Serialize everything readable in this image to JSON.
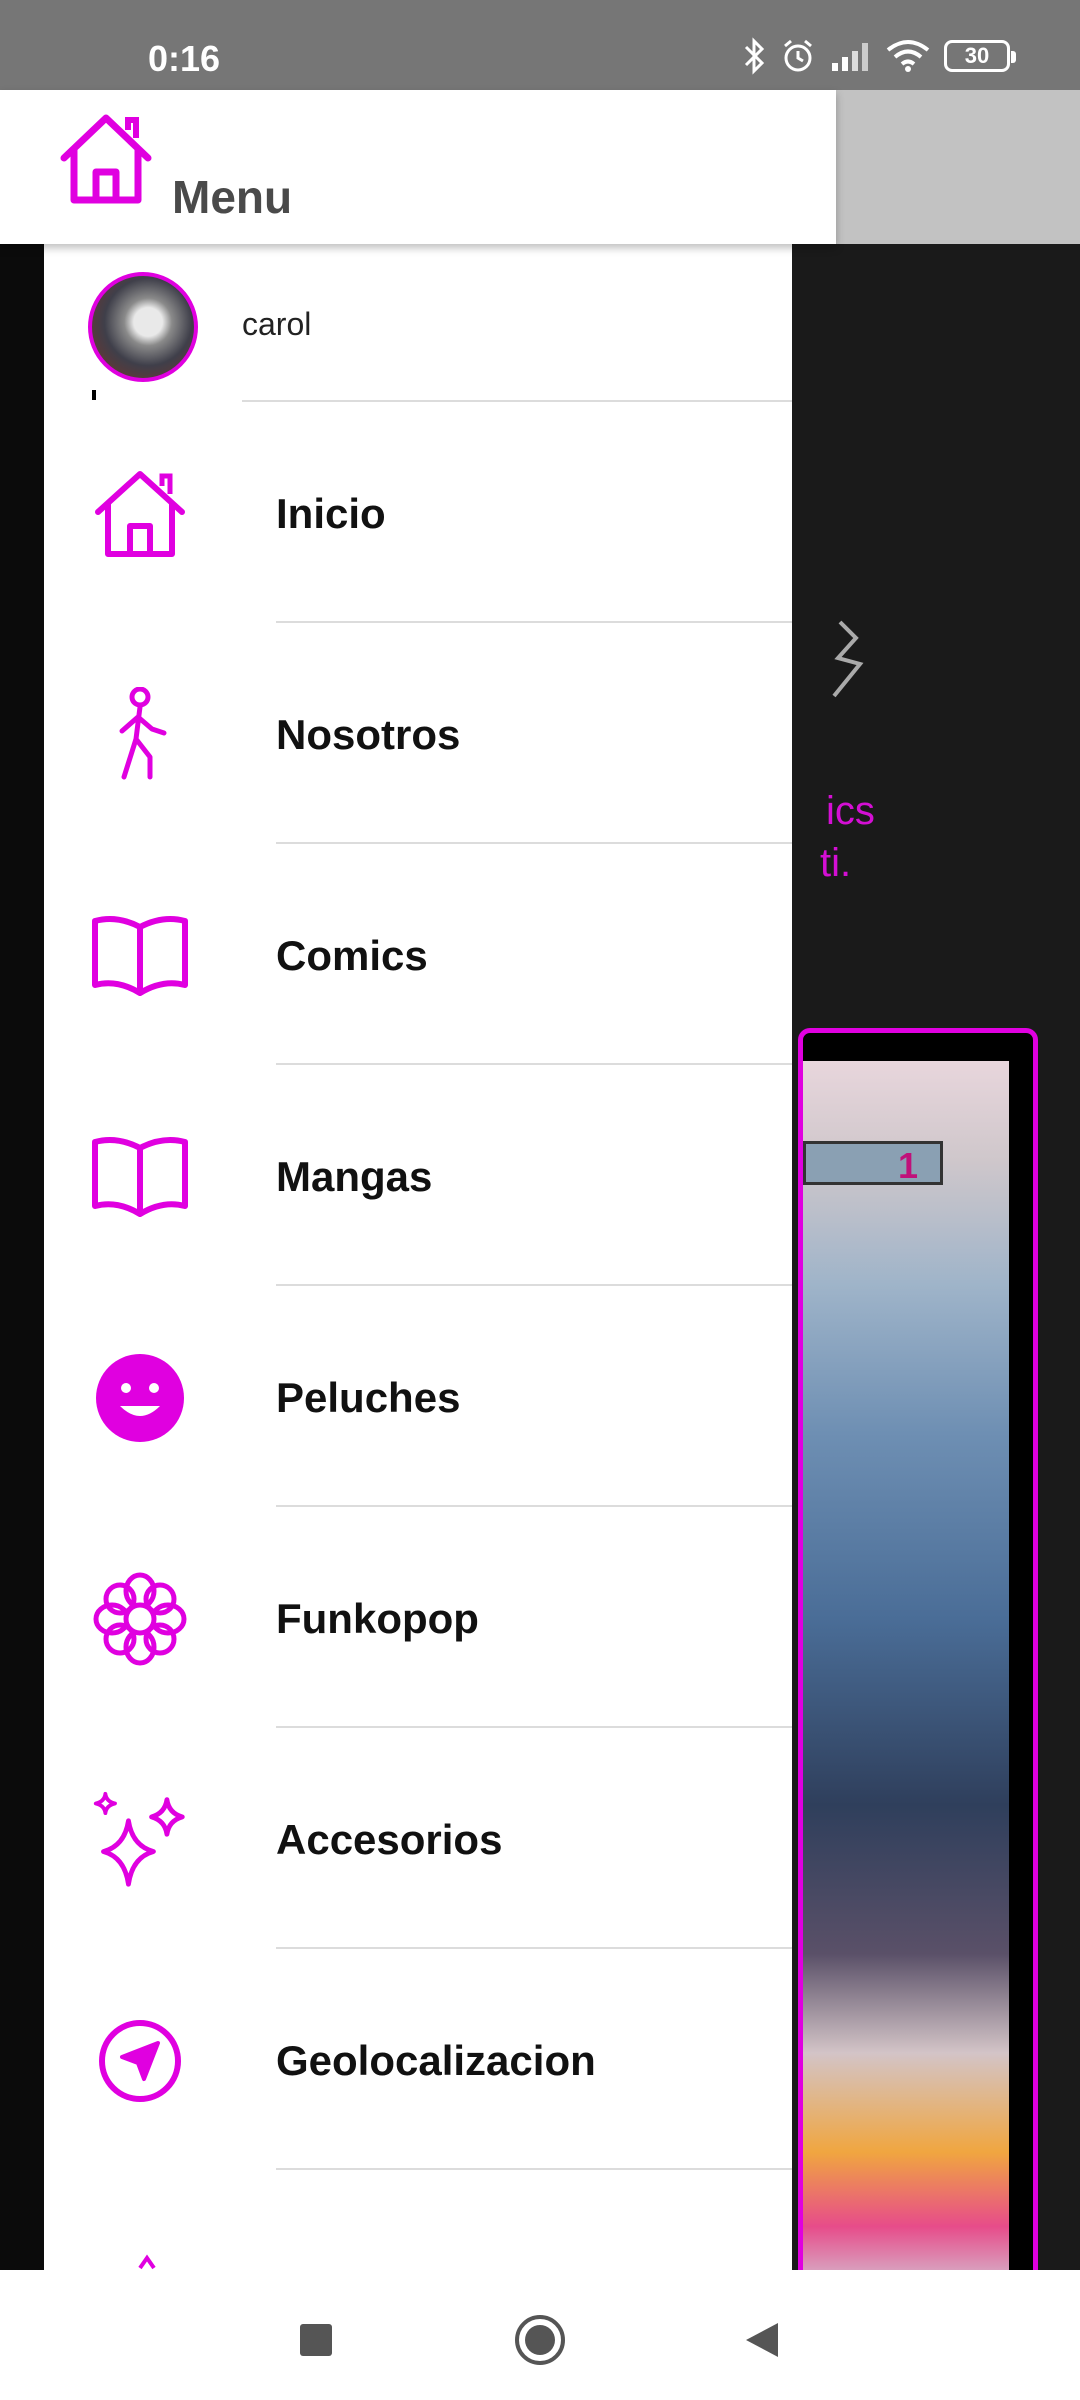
{
  "status_bar": {
    "time": "0:16",
    "battery": "30",
    "icons": [
      "bluetooth-icon",
      "alarm-icon",
      "signal-icon",
      "wifi-icon",
      "battery-icon"
    ]
  },
  "header": {
    "title": "Menu",
    "icon": "home-icon"
  },
  "profile": {
    "name": "carol"
  },
  "menu": {
    "items": [
      {
        "label": "Inicio",
        "icon": "home-icon"
      },
      {
        "label": "Nosotros",
        "icon": "walking-person-icon"
      },
      {
        "label": "Comics",
        "icon": "book-icon"
      },
      {
        "label": "Mangas",
        "icon": "book-icon"
      },
      {
        "label": "Peluches",
        "icon": "smiley-face-icon"
      },
      {
        "label": "Funkopop",
        "icon": "flower-icon"
      },
      {
        "label": "Accesorios",
        "icon": "sparkles-icon"
      },
      {
        "label": "Geolocalizacion",
        "icon": "navigation-arrow-icon"
      }
    ]
  },
  "background": {
    "tagline_line1": "ics",
    "tagline_line2": "ti."
  },
  "colors": {
    "accent": "#e000e0",
    "statusbar": "#767676",
    "drawer_bg": "#ffffff",
    "dark_bg": "#1a1a1a"
  },
  "nav_bar": {
    "buttons": [
      "recents-button",
      "home-button",
      "back-button"
    ]
  }
}
